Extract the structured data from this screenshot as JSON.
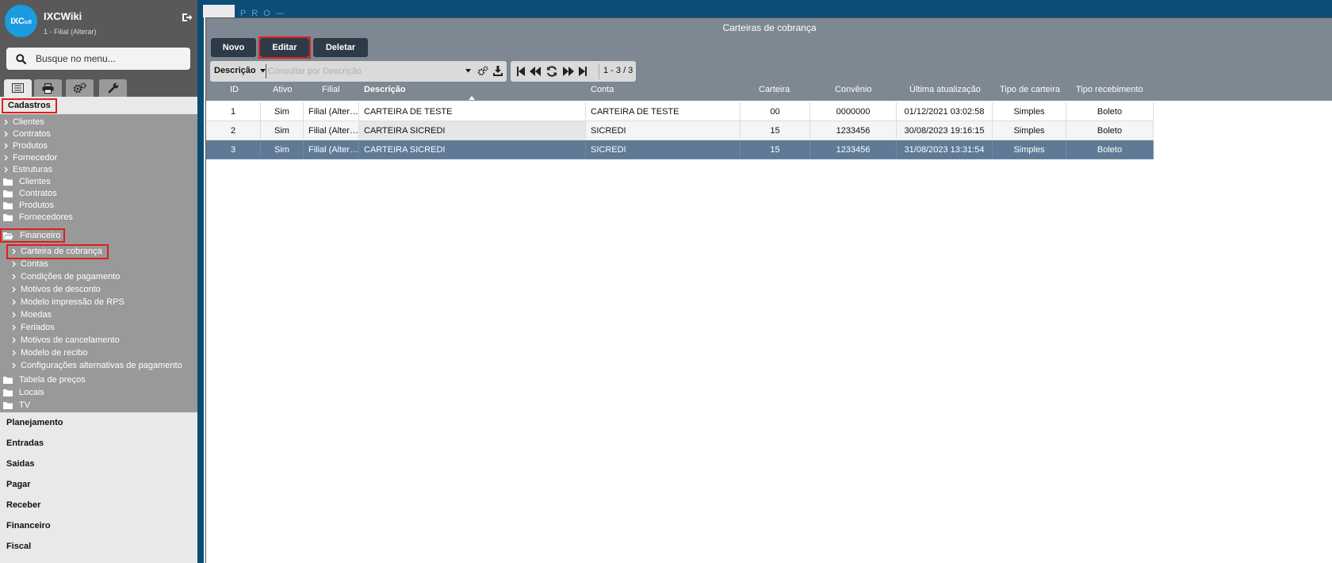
{
  "sidebar": {
    "logo_text": "IXC",
    "logo_sub": "soft",
    "app_title": "IXCWiki",
    "app_subtitle": "1 - Filial (Alterar)",
    "search_placeholder": "Busque no menu...",
    "tree_title": "Cadastros",
    "tree": {
      "top_items": [
        "Clientes",
        "Contratos",
        "Produtos",
        "Fornecedor",
        "Estruturas"
      ],
      "folders": [
        "Clientes",
        "Contratos",
        "Produtos",
        "Fornecedores"
      ],
      "open_folder": "Financeiro",
      "sub_items": [
        "Carteira de cobrança",
        "Contas",
        "Condições de pagamento",
        "Motivos de desconto",
        "Modelo impressão de RPS",
        "Moedas",
        "Feriados",
        "Motivos de cancelamento",
        "Modelo de recibo",
        "Configurações alternativas de pagamento"
      ],
      "after_folders": [
        "Tabela de preços",
        "Locais",
        "TV"
      ]
    },
    "sections": [
      "Planejamento",
      "Entradas",
      "Saidas",
      "Pagar",
      "Receber",
      "Financeiro",
      "Fiscal"
    ]
  },
  "background": {
    "strip_text": "P R O —"
  },
  "window": {
    "title": "Carteiras de cobrança",
    "toolbar": {
      "novo": "Novo",
      "editar": "Editar",
      "deletar": "Deletar"
    },
    "search": {
      "field": "Descrição",
      "placeholder": "Consultar por Descrição"
    },
    "pager": {
      "info": "1 - 3 / 3"
    },
    "columns": [
      "ID",
      "Ativo",
      "Filial",
      "Descrição",
      "Conta",
      "Carteira",
      "Convênio",
      "Última atualização",
      "Tipo de carteira",
      "Tipo recebimento"
    ],
    "rows": [
      [
        "1",
        "Sim",
        "Filial (Alterar)",
        "CARTEIRA DE TESTE",
        "CARTEIRA DE TESTE",
        "00",
        "0000000",
        "01/12/2021 03:02:58",
        "Simples",
        "Boleto"
      ],
      [
        "2",
        "Sim",
        "Filial (Alterar)",
        "CARTEIRA SICREDI",
        "SICREDI",
        "15",
        "1233456",
        "30/08/2023 19:16:15",
        "Simples",
        "Boleto"
      ],
      [
        "3",
        "Sim",
        "Filial (Alterar)",
        "CARTEIRA SICREDI",
        "SICREDI",
        "15",
        "1233456",
        "31/08/2023 13:31:54",
        "Simples",
        "Boleto"
      ]
    ],
    "selected_row": 2
  },
  "colors": {
    "accent_red": "#e01e1e",
    "header_gray": "#7e8893",
    "button_dark": "#2f3a47",
    "selected_row": "#5f7a96",
    "logo_blue": "#1b9be0"
  }
}
